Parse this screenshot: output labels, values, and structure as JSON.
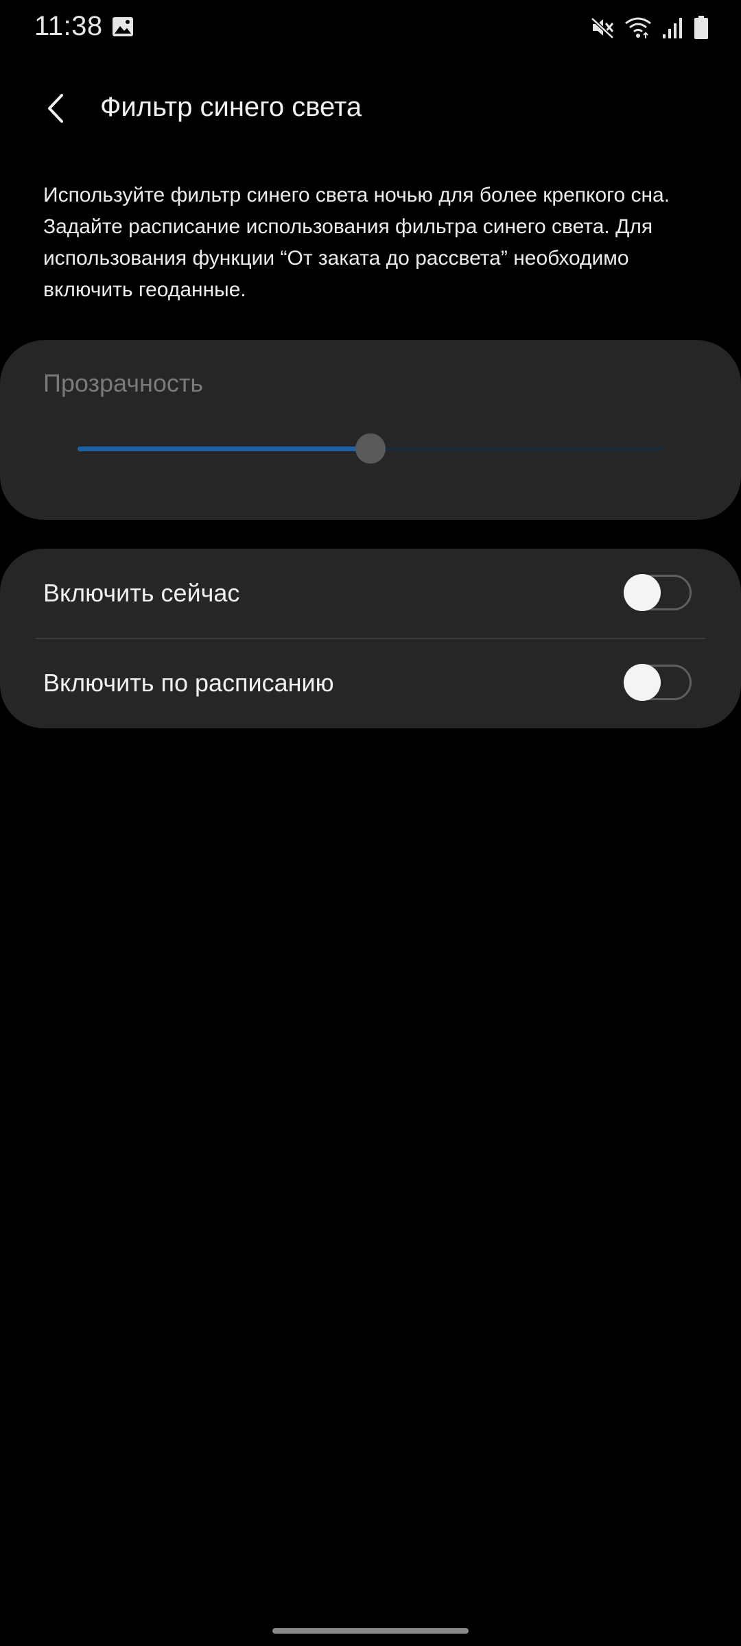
{
  "status_bar": {
    "time": "11:38",
    "icons": [
      "gallery-icon",
      "mute-icon",
      "wifi-icon",
      "signal-icon",
      "battery-icon"
    ]
  },
  "header": {
    "title": "Фильтр синего света",
    "back_icon": "chevron-left-icon"
  },
  "description": "Используйте фильтр синего света ночью для более крепкого сна. Задайте расписание использования фильтра синего света. Для использования функции “От заката до рассвета” необходимо включить геоданные.",
  "opacity": {
    "label": "Прозрачность",
    "value_fraction": 0.5,
    "enabled": false
  },
  "toggles": [
    {
      "label": "Включить сейчас",
      "on": false
    },
    {
      "label": "Включить по расписанию",
      "on": false
    }
  ],
  "colors": {
    "background": "#000000",
    "card": "#262626",
    "slider_fill": "#1b5fa6",
    "disabled_text": "#7a7a7a"
  }
}
